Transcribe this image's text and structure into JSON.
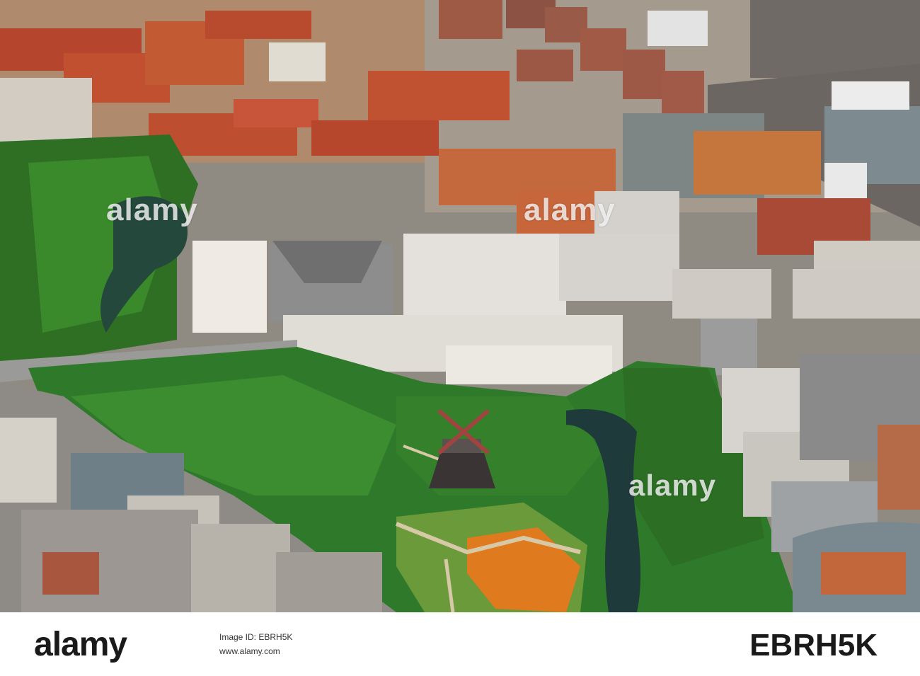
{
  "photo": {
    "subject": "Aerial view of a city quarter with a park, a windmill on a green hill, a moat/canal and dense urban blocks",
    "palette": {
      "tree_green": "#2f7a2a",
      "lawn_green": "#6b9a3a",
      "water": "#1f3a3a",
      "roof_red": "#b5452c",
      "concrete": "#cfcfcf",
      "flowerbed": "#e07a1e"
    }
  },
  "watermarks": {
    "left": "alamy",
    "middle": "alamy",
    "park": "alamy"
  },
  "footer": {
    "logo": "alamy",
    "stock_id": "EBRH5K",
    "image_id_label": "Image ID: EBRH5K",
    "url": "www.alamy.com"
  }
}
